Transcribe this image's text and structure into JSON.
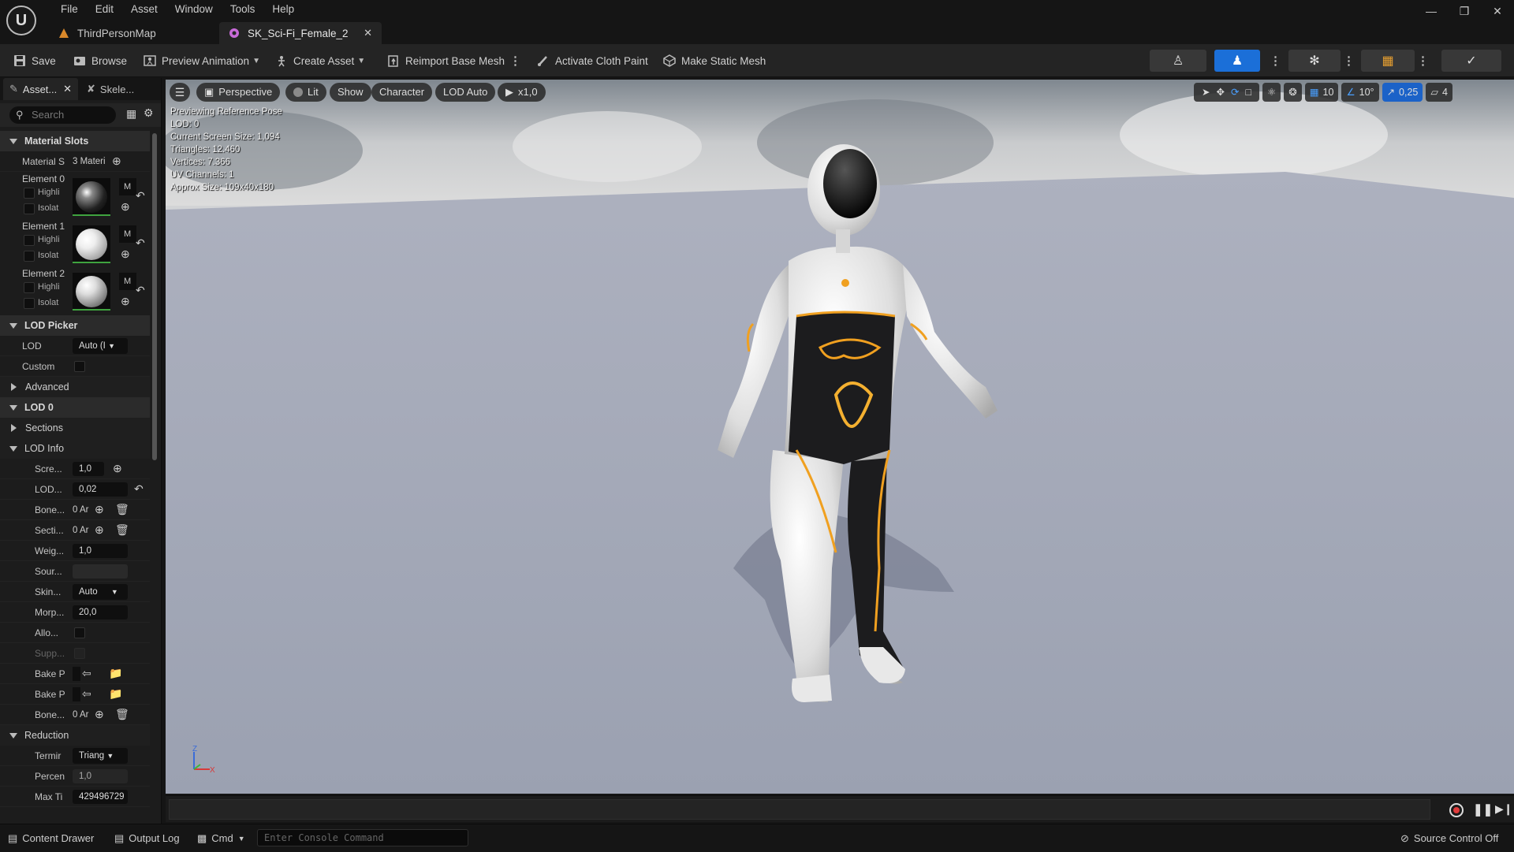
{
  "menu": [
    "File",
    "Edit",
    "Asset",
    "Window",
    "Tools",
    "Help"
  ],
  "tabs": [
    {
      "label": "ThirdPersonMap",
      "active": false
    },
    {
      "label": "SK_Sci-Fi_Female_2",
      "active": true
    }
  ],
  "toolbar": {
    "save": "Save",
    "browse": "Browse",
    "preview_animation": "Preview Animation",
    "create_asset": "Create Asset",
    "reimport": "Reimport Base Mesh",
    "cloth_paint": "Activate Cloth Paint",
    "static_mesh": "Make Static Mesh"
  },
  "panel_tabs": {
    "asset": "Asset...",
    "skeleton": "Skele..."
  },
  "search": {
    "placeholder": "Search"
  },
  "material_slots": {
    "title": "Material Slots",
    "slots_label": "Material S",
    "slots_value": "3 Materi",
    "elements": [
      {
        "label": "Element 0",
        "highlight": "Highli",
        "isolate": "Isolat",
        "m": "M"
      },
      {
        "label": "Element 1",
        "highlight": "Highli",
        "isolate": "Isolat",
        "m": "M"
      },
      {
        "label": "Element 2",
        "highlight": "Highli",
        "isolate": "Isolat",
        "m": "M"
      }
    ]
  },
  "lod_picker": {
    "title": "LOD Picker",
    "lod_label": "LOD",
    "lod_value": "Auto (I",
    "custom_label": "Custom"
  },
  "advanced": "Advanced",
  "lod0": {
    "title": "LOD 0",
    "sections": "Sections",
    "lod_info": "LOD Info"
  },
  "lod_info_rows": {
    "screen": {
      "label": "Scre...",
      "value": "1,0"
    },
    "lod_hysteresis": {
      "label": "LOD...",
      "value": "0,02"
    },
    "bones": {
      "label": "Bone...",
      "value": "0 Ar"
    },
    "sections": {
      "label": "Secti...",
      "value": "0 Ar"
    },
    "weight": {
      "label": "Weig...",
      "value": "1,0"
    },
    "source": {
      "label": "Sour...",
      "value": ""
    },
    "skin": {
      "label": "Skin...",
      "value": "Auto"
    },
    "morph": {
      "label": "Morp...",
      "value": "20,0"
    },
    "allow": {
      "label": "Allo..."
    },
    "support": {
      "label": "Supp..."
    },
    "bake1": {
      "label": "Bake P"
    },
    "bake2": {
      "label": "Bake P"
    },
    "bones2": {
      "label": "Bone...",
      "value": "0 Ar"
    }
  },
  "reduction": {
    "title": "Reduction",
    "termination": {
      "label": "Termir",
      "value": "Triang"
    },
    "percent": {
      "label": "Percen",
      "value": "1,0"
    },
    "max": {
      "label": "Max Ti",
      "value": "429496729"
    }
  },
  "viewport": {
    "perspective": "Perspective",
    "lit": "Lit",
    "show": "Show",
    "character": "Character",
    "lod": "LOD Auto",
    "speed": "x1,0",
    "stats": [
      "Previewing Reference Pose",
      "LOD: 0",
      "Current Screen Size: 1,094",
      "Triangles: 12.460",
      "Vertices: 7.366",
      "UV Channels: 1",
      "Approx Size: 109x40x180"
    ],
    "grid_snap": "10",
    "rot_snap": "10°",
    "scale_snap": "0,25",
    "camera_speed": "4",
    "axis_z": "Z",
    "axis_x": "X"
  },
  "statusbar": {
    "content_drawer": "Content Drawer",
    "output_log": "Output Log",
    "cmd": "Cmd",
    "console_placeholder": "Enter Console Command",
    "source_control": "Source Control Off"
  },
  "colors": {
    "accent_blue": "#1b6fd8",
    "glow_orange": "#f0a020",
    "suit_white": "#e8e8e8",
    "suit_black": "#1c1c1e"
  }
}
